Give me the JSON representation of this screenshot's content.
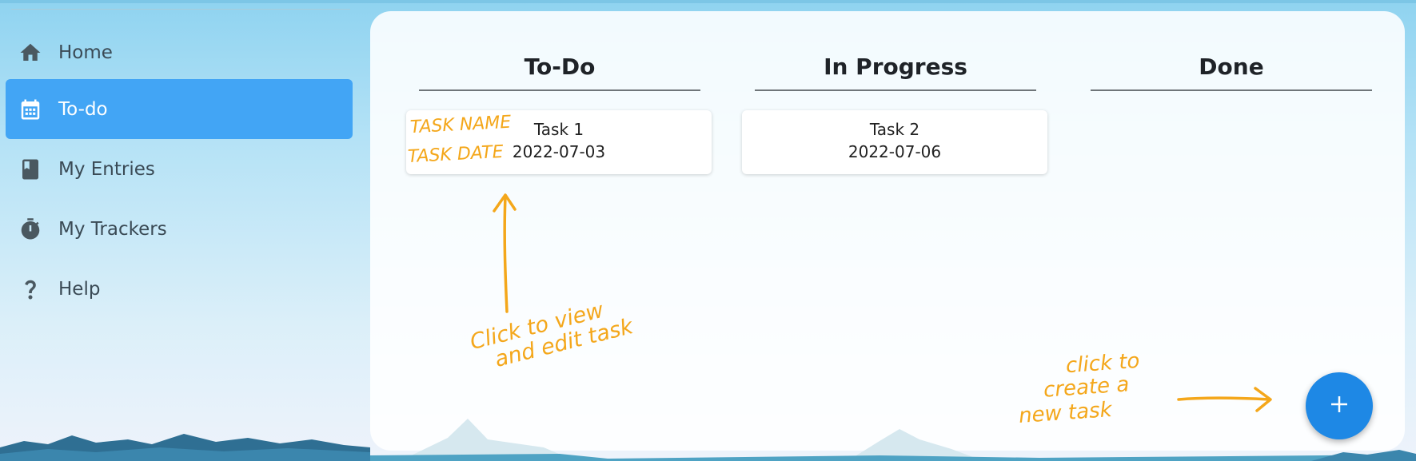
{
  "sidebar": {
    "items": [
      {
        "label": "Home",
        "icon": "home-icon",
        "active": false
      },
      {
        "label": "To-do",
        "icon": "calendar-icon",
        "active": true
      },
      {
        "label": "My Entries",
        "icon": "book-icon",
        "active": false
      },
      {
        "label": "My Trackers",
        "icon": "stopwatch-icon",
        "active": false
      },
      {
        "label": "Help",
        "icon": "help-icon",
        "active": false
      }
    ]
  },
  "board": {
    "columns": [
      {
        "title": "To-Do"
      },
      {
        "title": "In Progress"
      },
      {
        "title": "Done"
      }
    ],
    "cards": [
      {
        "name": "Task 1",
        "date": "2022-07-03",
        "column": "To-Do"
      },
      {
        "name": "Task 2",
        "date": "2022-07-06",
        "column": "In Progress"
      }
    ]
  },
  "annotations": {
    "task_name": "TASK NAME",
    "task_date": "TASK DATE",
    "view_edit_line1": "Click to view",
    "view_edit_line2": "and edit task",
    "create_line1": "click to",
    "create_line2": "create a",
    "create_line3": "new task",
    "color": "#f4a71b"
  },
  "fab": {
    "icon": "plus-icon",
    "symbol": "+"
  },
  "colors": {
    "accent": "#42a5f5",
    "fab": "#1e88e5"
  }
}
